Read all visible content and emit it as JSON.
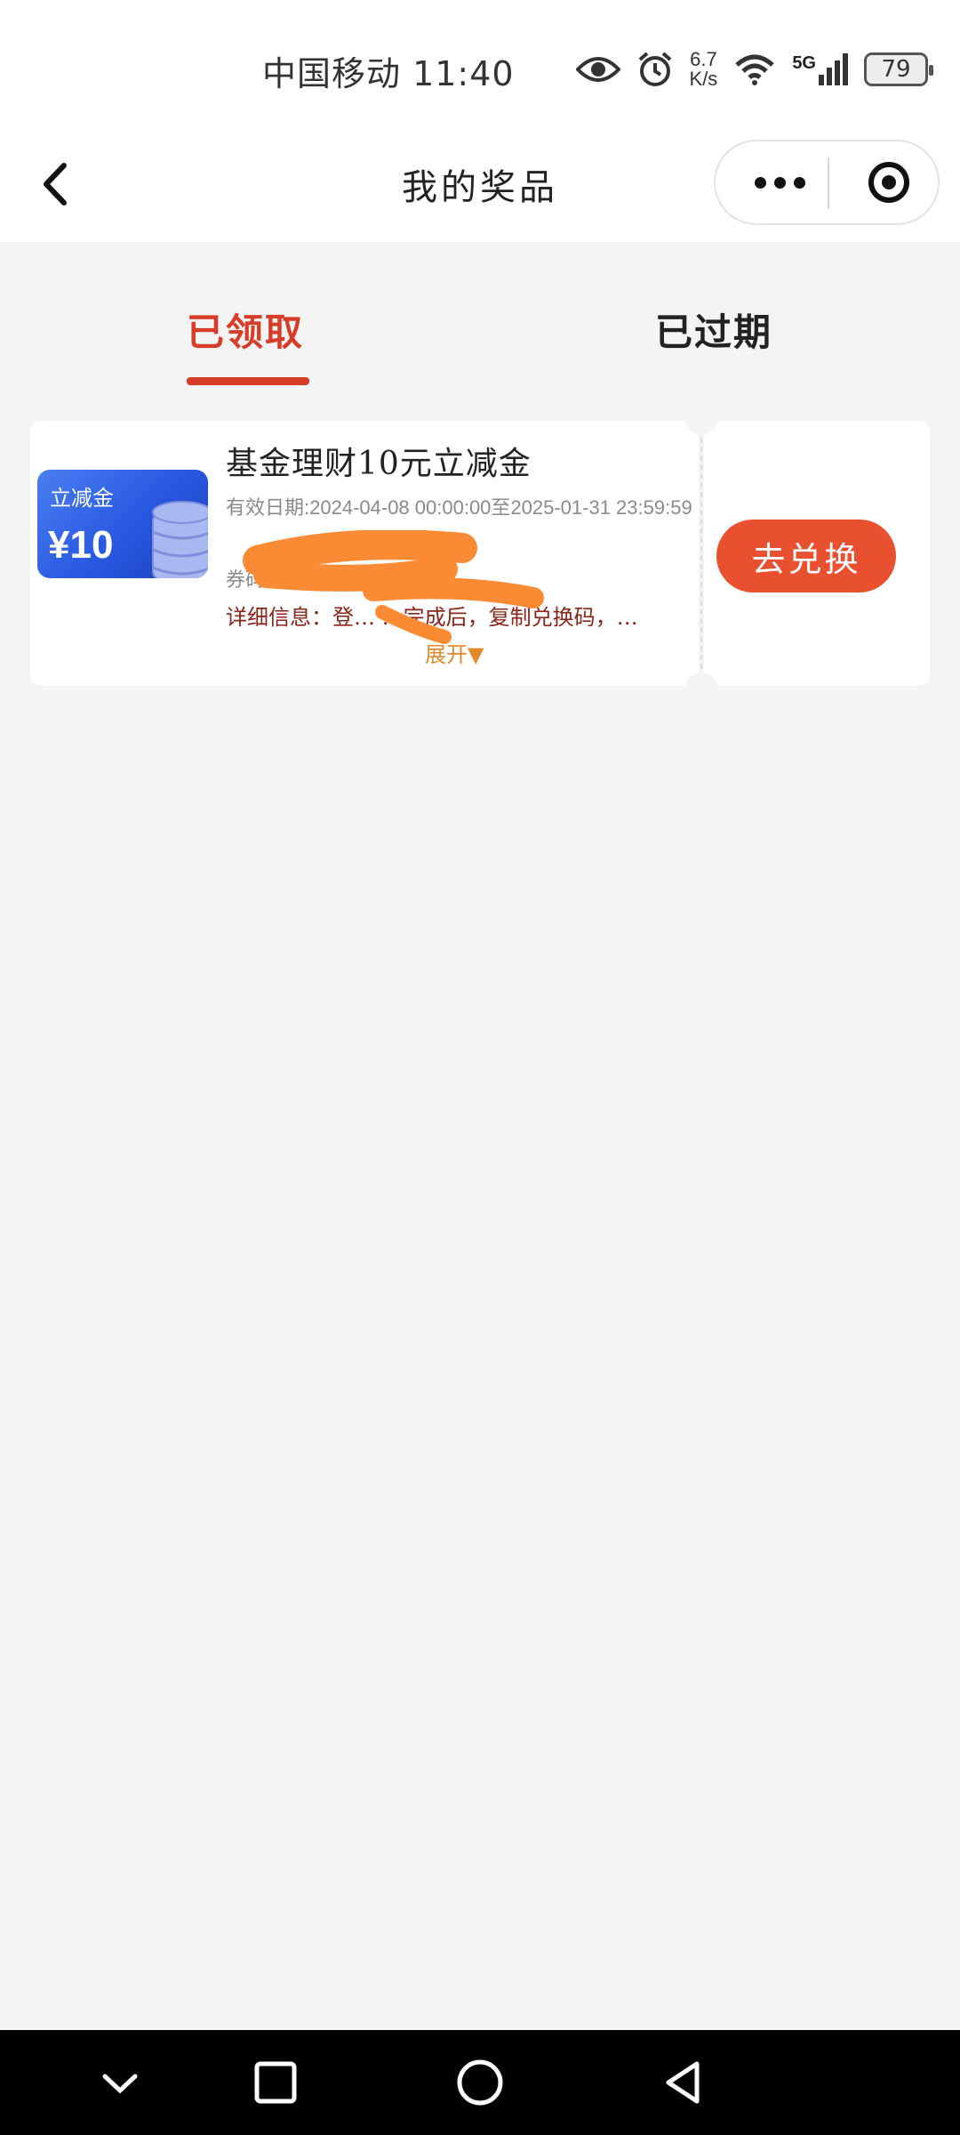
{
  "status_bar": {
    "carrier_time": "中国移动 11:40",
    "net_speed_value": "6.7",
    "net_speed_unit": "K/s",
    "network": "5G",
    "battery": "79",
    "icons": [
      "eye-icon",
      "alarm-icon",
      "wifi-icon",
      "signal-icon",
      "battery-icon"
    ]
  },
  "nav": {
    "title": "我的奖品",
    "back_icon": "chevron-left-icon",
    "more_icon": "more-dots-icon",
    "close_icon": "target-close-icon"
  },
  "tabs": [
    {
      "label": "已领取",
      "active": true
    },
    {
      "label": "已过期",
      "active": false
    }
  ],
  "prize": {
    "badge_label": "立减金",
    "badge_amount": "¥10",
    "title": "基金理财10元立减金",
    "validity_label": "有效日期:",
    "validity_range": "2024-04-08  00:00:00至2025-01-31 23:59:59",
    "code_label": "券码:",
    "detail_text": "详细信息：登…  …完成后，复制兑换码，…",
    "expand_label": "展开▼",
    "redeem_label": "去兑换"
  },
  "colors": {
    "accent": "#d63c28",
    "button": "#e8502f",
    "background": "#f4f4f4",
    "coupon_blue": "#2757e0",
    "redaction": "#fb8a34"
  },
  "system_nav": {
    "icons": [
      "chevron-down-icon",
      "square-recents-icon",
      "circle-home-icon",
      "triangle-back-icon"
    ]
  }
}
